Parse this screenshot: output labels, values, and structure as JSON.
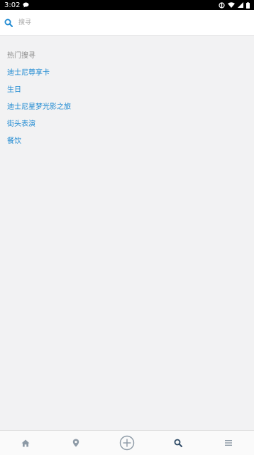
{
  "status_bar": {
    "time": "3:02",
    "left_icons": [
      "chat-bubble-icon"
    ],
    "right_icons": [
      "sync-icon",
      "wifi-icon",
      "signal-icon",
      "battery-icon"
    ]
  },
  "search": {
    "placeholder": "搜寻",
    "value": ""
  },
  "hot": {
    "title": "热门搜寻",
    "items": [
      "迪士尼尊享卡",
      "生日",
      "迪士尼星梦光影之旅",
      "街头表演",
      "餐饮"
    ]
  },
  "bottom_nav": {
    "items": [
      "home-icon",
      "location-pin-icon",
      "add-circle-icon",
      "search-icon",
      "menu-icon"
    ],
    "active": "search-icon"
  },
  "colors": {
    "accent": "#1f8ad2",
    "nav_icon": "#8d9aa6",
    "nav_active": "#2e4a66"
  }
}
